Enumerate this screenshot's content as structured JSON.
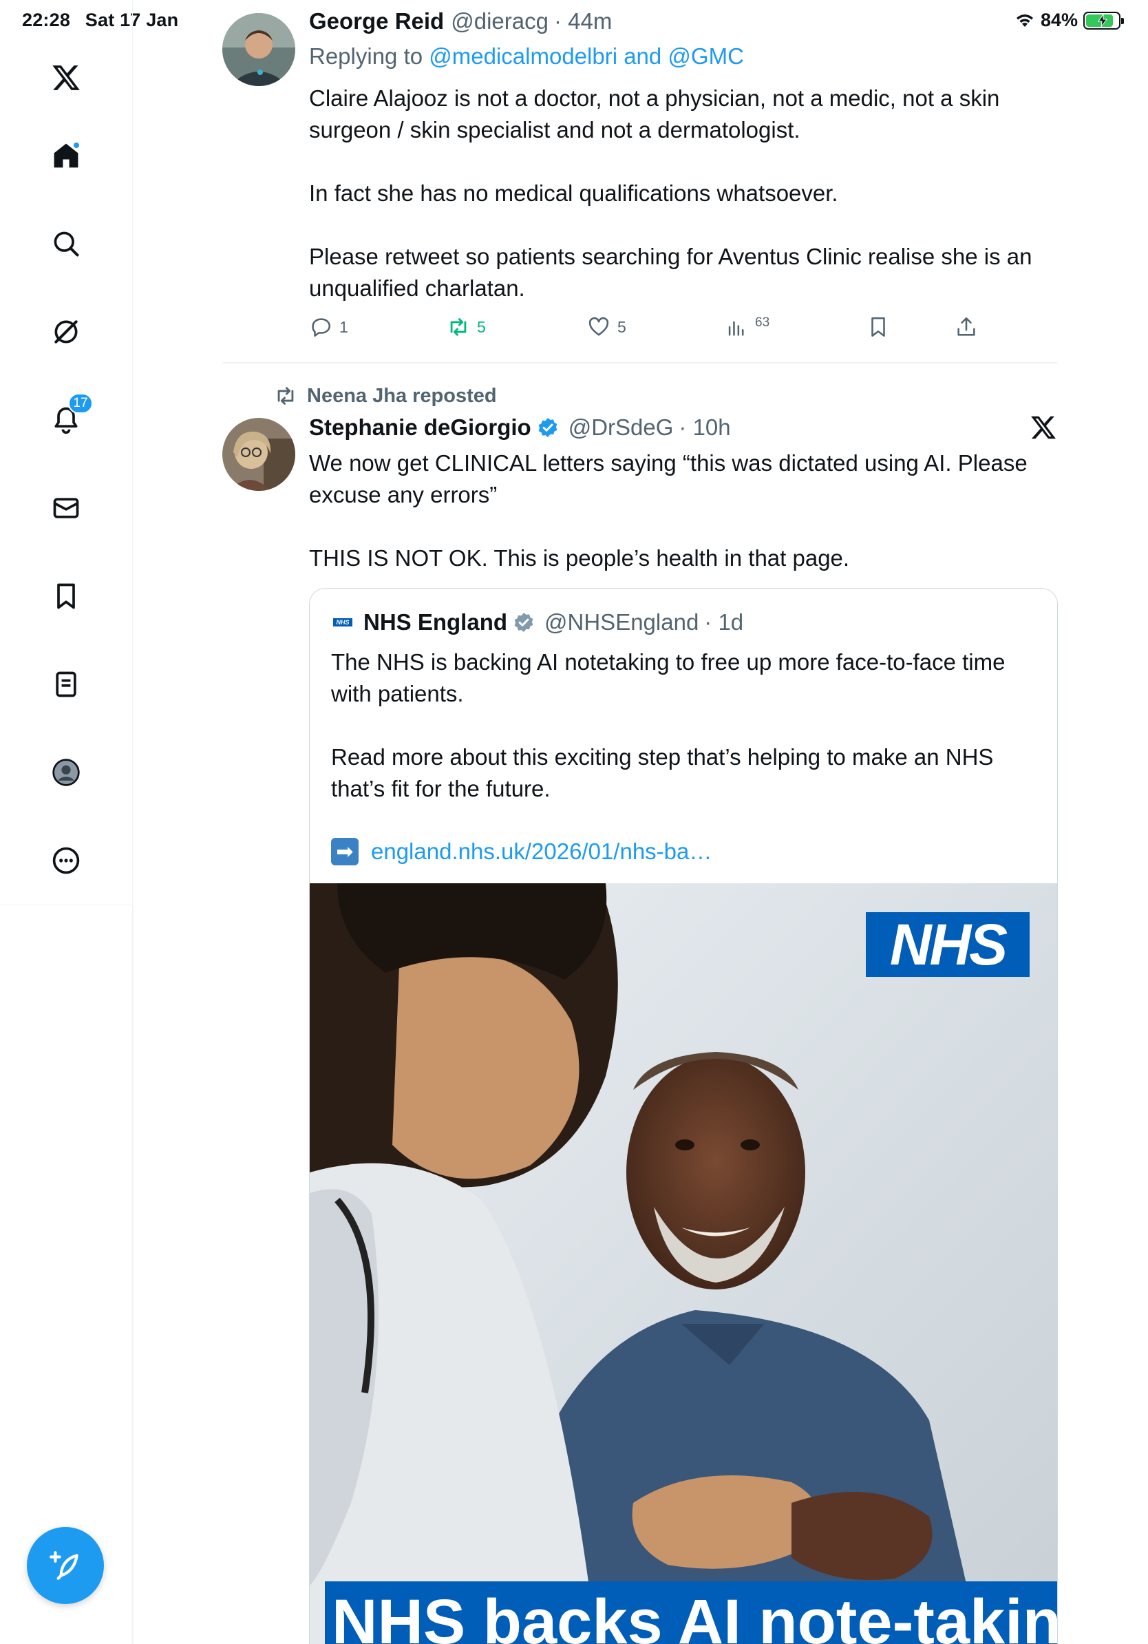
{
  "status_bar": {
    "time": "22:28",
    "date": "Sat 17 Jan",
    "battery": "84%",
    "battery_level": 0.84
  },
  "sidebar": {
    "items": [
      {
        "name": "x-logo",
        "icon": "x-logo-icon"
      },
      {
        "name": "home",
        "icon": "home-icon",
        "has_dot": true
      },
      {
        "name": "explore",
        "icon": "search-icon"
      },
      {
        "name": "grok",
        "icon": "grok-icon"
      },
      {
        "name": "notifications",
        "icon": "bell-icon",
        "badge": "17"
      },
      {
        "name": "messages",
        "icon": "mail-icon"
      },
      {
        "name": "bookmarks",
        "icon": "bookmark-icon"
      },
      {
        "name": "lists",
        "icon": "list-icon"
      },
      {
        "name": "profile",
        "icon": "profile-icon"
      },
      {
        "name": "more",
        "icon": "more-icon"
      }
    ],
    "compose_icon": "feather-plus-icon"
  },
  "tweet1": {
    "name": "George Reid",
    "handle": "@dieracg",
    "time": "· 44m",
    "replying_prefix": "Replying to ",
    "replying_targets": "@medicalmodelbri and @GMC",
    "text": "Claire Alajooz is not a doctor, not a physician, not a medic, not a skin surgeon / skin specialist and not a dermatologist.\n\nIn fact she has no medical qualifications whatsoever.\n\nPlease retweet so patients searching for Aventus Clinic realise she is an unqualified charlatan.",
    "replies": "1",
    "reposts": "5",
    "likes": "5",
    "views": "63"
  },
  "tweet2": {
    "reposted_by": "Neena Jha reposted",
    "name": "Stephanie deGiorgio",
    "handle": "@DrSdeG",
    "time": "· 10h",
    "text": "We now get CLINICAL letters saying “this was dictated using AI. Please excuse any errors”\n\nTHIS IS NOT OK. This is people’s health in that page.",
    "quote": {
      "logo_text": "NHS",
      "name": "NHS England",
      "handle": "@NHSEngland",
      "time": "· 1d",
      "text": "The NHS is backing AI notetaking to free up more face-to-face time with patients.\n\nRead more about this exciting step that’s helping to make an NHS that’s fit for the future.",
      "link_arrow": "➡",
      "link": "england.nhs.uk/2026/01/nhs-ba…",
      "image_logo": "NHS",
      "image_headline": "NHS backs AI note-taking"
    }
  },
  "colors": {
    "accent": "#1d9bf0",
    "repost_green": "#00ba7c",
    "nhs_blue": "#005eb8",
    "muted": "#536471"
  }
}
